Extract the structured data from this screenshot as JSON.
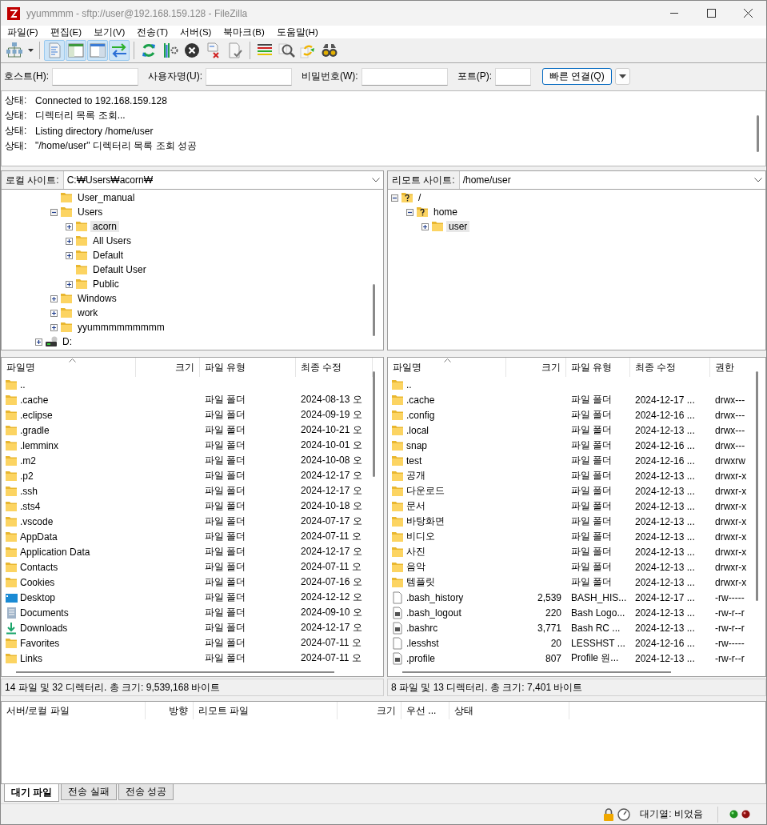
{
  "window": {
    "title": "yyummmm - sftp://user@192.168.159.128 - FileZilla"
  },
  "menu": [
    "파일(F)",
    "편집(E)",
    "보기(V)",
    "전송(T)",
    "서버(S)",
    "북마크(B)",
    "도움말(H)"
  ],
  "toolbar": {
    "groups": [
      [
        {
          "pressed": false
        },
        {
          "pressed": false
        }
      ],
      [
        {
          "pressed": true
        },
        {
          "pressed": true
        },
        {
          "pressed": true
        },
        {
          "pressed": true
        }
      ],
      [
        {
          "pressed": false
        },
        {
          "pressed": false
        },
        {
          "pressed": false
        },
        {
          "pressed": false
        },
        {
          "pressed": false
        }
      ],
      [
        {
          "pressed": false
        },
        {
          "pressed": false
        },
        {
          "pressed": false
        },
        {
          "pressed": false
        }
      ]
    ]
  },
  "quickconnect": {
    "fields": [
      {
        "label": "호스트(H):",
        "kind": "wide"
      },
      {
        "label": "사용자명(U):",
        "kind": "wide"
      },
      {
        "label": "비밀번호(W):",
        "kind": "wide"
      },
      {
        "label": "포트(P):",
        "kind": "narrow"
      }
    ],
    "button": "빠른 연결(Q)"
  },
  "log": [
    {
      "label": "상태:",
      "text": "Connected to 192.168.159.128"
    },
    {
      "label": "상태:",
      "text": "디렉터리 목록 조회..."
    },
    {
      "label": "상태:",
      "text": "Listing directory /home/user"
    },
    {
      "label": "상태:",
      "text": "\"/home/user\" 디렉터리 목록 조회 성공"
    }
  ],
  "local": {
    "site_label": "로컬 사이트:",
    "path": "C:₩Users₩acorn₩",
    "tree": [
      {
        "children": [
          {
            "label": "User_manual",
            "kind": "folder",
            "selected": false
          },
          {
            "label": "Users",
            "kind": "folder",
            "expanded": true,
            "selected": false,
            "children": [
              {
                "label": "acorn",
                "kind": "folder",
                "expanded": false,
                "selected": true
              },
              {
                "label": "All Users",
                "kind": "folder",
                "expanded": false,
                "selected": false
              },
              {
                "label": "Default",
                "kind": "folder",
                "expanded": false,
                "selected": false
              },
              {
                "label": "Default User",
                "kind": "folder",
                "selected": false
              },
              {
                "label": "Public",
                "kind": "folder",
                "expanded": false,
                "selected": false
              }
            ]
          },
          {
            "label": "Windows",
            "kind": "folder",
            "expanded": false,
            "selected": false
          },
          {
            "label": "work",
            "kind": "folder",
            "expanded": false,
            "selected": false
          },
          {
            "label": "yyummmmmmmmm",
            "kind": "folder",
            "expanded": false,
            "selected": false
          }
        ]
      },
      {
        "label": "D:",
        "kind": "drive",
        "expanded": false,
        "selected": false
      }
    ],
    "columns": [
      "파일명",
      "크기",
      "파일 유형",
      "최종 수정"
    ],
    "rows": [
      {
        "kind": "folder",
        "name": ".."
      },
      {
        "kind": "folder",
        "name": ".cache",
        "type": "파일 폴더",
        "modified": "2024-08-13 오"
      },
      {
        "kind": "folder",
        "name": ".eclipse",
        "type": "파일 폴더",
        "modified": "2024-09-19 오"
      },
      {
        "kind": "folder",
        "name": ".gradle",
        "type": "파일 폴더",
        "modified": "2024-10-21 오"
      },
      {
        "kind": "folder",
        "name": ".lemminx",
        "type": "파일 폴더",
        "modified": "2024-10-01 오"
      },
      {
        "kind": "folder",
        "name": ".m2",
        "type": "파일 폴더",
        "modified": "2024-10-08 오"
      },
      {
        "kind": "folder",
        "name": ".p2",
        "type": "파일 폴더",
        "modified": "2024-12-17 오"
      },
      {
        "kind": "folder",
        "name": ".ssh",
        "type": "파일 폴더",
        "modified": "2024-12-17 오"
      },
      {
        "kind": "folder",
        "name": ".sts4",
        "type": "파일 폴더",
        "modified": "2024-10-18 오"
      },
      {
        "kind": "folder",
        "name": ".vscode",
        "type": "파일 폴더",
        "modified": "2024-07-17 오"
      },
      {
        "kind": "folder",
        "name": "AppData",
        "type": "파일 폴더",
        "modified": "2024-07-11 오"
      },
      {
        "kind": "folder",
        "name": "Application Data",
        "type": "파일 폴더",
        "modified": "2024-12-17 오"
      },
      {
        "kind": "folder",
        "name": "Contacts",
        "type": "파일 폴더",
        "modified": "2024-07-11 오"
      },
      {
        "kind": "folder",
        "name": "Cookies",
        "type": "파일 폴더",
        "modified": "2024-07-16 오"
      },
      {
        "kind": "desktop",
        "name": "Desktop",
        "type": "파일 폴더",
        "modified": "2024-12-12 오"
      },
      {
        "kind": "documents",
        "name": "Documents",
        "type": "파일 폴더",
        "modified": "2024-09-10 오"
      },
      {
        "kind": "downloads",
        "name": "Downloads",
        "type": "파일 폴더",
        "modified": "2024-12-17 오"
      },
      {
        "kind": "folder",
        "name": "Favorites",
        "type": "파일 폴더",
        "modified": "2024-07-11 오"
      },
      {
        "kind": "folder",
        "name": "Links",
        "type": "파일 폴더",
        "modified": "2024-07-11 오"
      }
    ],
    "summary": "14 파일 및 32 디렉터리. 총 크기: 9,539,168 바이트"
  },
  "remote": {
    "site_label": "리모트 사이트:",
    "path": "/home/user",
    "tree": [
      {
        "label": "/",
        "kind": "unknown",
        "expanded": true,
        "selected": false,
        "children": [
          {
            "label": "home",
            "kind": "unknown",
            "expanded": true,
            "selected": false,
            "children": [
              {
                "label": "user",
                "kind": "folder",
                "expanded": false,
                "selected": true
              }
            ]
          }
        ]
      }
    ],
    "columns": [
      "파일명",
      "크기",
      "파일 유형",
      "최종 수정",
      "권한"
    ],
    "rows": [
      {
        "kind": "folder",
        "name": ".."
      },
      {
        "kind": "folder",
        "name": ".cache",
        "type": "파일 폴더",
        "modified": "2024-12-17 ...",
        "permissions": "drwx---"
      },
      {
        "kind": "folder",
        "name": ".config",
        "type": "파일 폴더",
        "modified": "2024-12-16 ...",
        "permissions": "drwx---"
      },
      {
        "kind": "folder",
        "name": ".local",
        "type": "파일 폴더",
        "modified": "2024-12-13 ...",
        "permissions": "drwx---"
      },
      {
        "kind": "folder",
        "name": "snap",
        "type": "파일 폴더",
        "modified": "2024-12-16 ...",
        "permissions": "drwx---"
      },
      {
        "kind": "folder",
        "name": "test",
        "type": "파일 폴더",
        "modified": "2024-12-16 ...",
        "permissions": "drwxrw"
      },
      {
        "kind": "folder",
        "name": "공개",
        "type": "파일 폴더",
        "modified": "2024-12-13 ...",
        "permissions": "drwxr-x"
      },
      {
        "kind": "folder",
        "name": "다운로드",
        "type": "파일 폴더",
        "modified": "2024-12-13 ...",
        "permissions": "drwxr-x"
      },
      {
        "kind": "folder",
        "name": "문서",
        "type": "파일 폴더",
        "modified": "2024-12-13 ...",
        "permissions": "drwxr-x"
      },
      {
        "kind": "folder",
        "name": "바탕화면",
        "type": "파일 폴더",
        "modified": "2024-12-13 ...",
        "permissions": "drwxr-x"
      },
      {
        "kind": "folder",
        "name": "비디오",
        "type": "파일 폴더",
        "modified": "2024-12-13 ...",
        "permissions": "drwxr-x"
      },
      {
        "kind": "folder",
        "name": "사진",
        "type": "파일 폴더",
        "modified": "2024-12-13 ...",
        "permissions": "drwxr-x"
      },
      {
        "kind": "folder",
        "name": "음악",
        "type": "파일 폴더",
        "modified": "2024-12-13 ...",
        "permissions": "drwxr-x"
      },
      {
        "kind": "folder",
        "name": "템플릿",
        "type": "파일 폴더",
        "modified": "2024-12-13 ...",
        "permissions": "drwxr-x"
      },
      {
        "kind": "file",
        "name": ".bash_history",
        "size": "2,539",
        "type": "BASH_HIS...",
        "modified": "2024-12-17 ...",
        "permissions": "-rw-----"
      },
      {
        "kind": "script",
        "name": ".bash_logout",
        "size": "220",
        "type": "Bash Logo...",
        "modified": "2024-12-13 ...",
        "permissions": "-rw-r--r"
      },
      {
        "kind": "script",
        "name": ".bashrc",
        "size": "3,771",
        "type": "Bash RC ...",
        "modified": "2024-12-13 ...",
        "permissions": "-rw-r--r"
      },
      {
        "kind": "file",
        "name": ".lesshst",
        "size": "20",
        "type": "LESSHST ...",
        "modified": "2024-12-16 ...",
        "permissions": "-rw-----"
      },
      {
        "kind": "script",
        "name": ".profile",
        "size": "807",
        "type": "Profile 원...",
        "modified": "2024-12-13 ...",
        "permissions": "-rw-r--r"
      }
    ],
    "summary": "8 파일 및 13 디렉터리. 총 크기: 7,401 바이트"
  },
  "queue": {
    "columns": [
      "서버/로컬 파일",
      "방향",
      "리모트 파일",
      "크기",
      "우선 ...",
      "상태"
    ],
    "tabs": [
      {
        "label": "대기 파일",
        "selected": true
      },
      {
        "label": "전송 실패",
        "selected": false
      },
      {
        "label": "전송 성공",
        "selected": false
      }
    ]
  },
  "status_bar": {
    "queue_text": "대기열: 비었음"
  }
}
